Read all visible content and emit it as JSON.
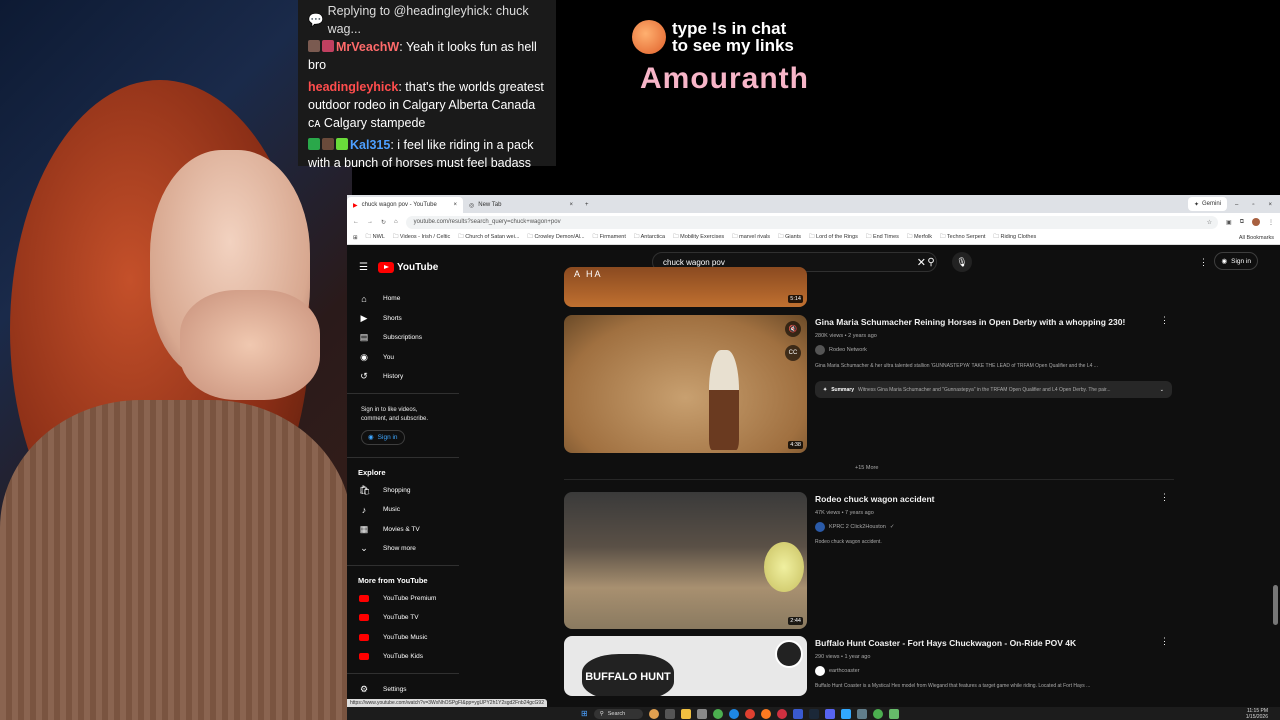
{
  "chat": {
    "reply": "Replying to @headingleyhick: chuck wag...",
    "messages": [
      {
        "user": "MrVeachW",
        "text": "Yeah it looks fun as hell bro"
      },
      {
        "user": "headingleyhick",
        "text": "that's the worlds greatest outdoor rodeo in Calgary Alberta Canada ᴄᴀ Calgary stampede"
      },
      {
        "user": "Kal315",
        "text": "i feel like riding in a pack with a bunch of horses must feel badass"
      }
    ]
  },
  "promo": {
    "line1": "type !s in chat",
    "line2": "to see my links",
    "name": "Amouranth"
  },
  "browser": {
    "tabs": [
      "chuck wagon pov - YouTube",
      "New Tab"
    ],
    "gemini": "Gemini",
    "url": "youtube.com/results?search_query=chuck+wagon+pov",
    "bookmarks": [
      "NWL",
      "Videos - Irish / Celtic",
      "Church of Satan wei...",
      "Crowley Demon/Al...",
      "Firmament",
      "Antarctica",
      "Mobility Exercises",
      "marvel rivals",
      "Giants",
      "Lord of the Rings",
      "End Times",
      "Merfolk",
      "Techno Serpent",
      "Riding Clothes"
    ],
    "all_bookmarks": "All Bookmarks",
    "status_url": "https://www.youtube.com/watch?v=3WxNhOSPgFI&pp=ygUPY2h1Y2sgd2Fnb24gcG92"
  },
  "youtube": {
    "logo": "YouTube",
    "search_value": "chuck wagon pov",
    "signin": "Sign in",
    "sidebar": {
      "main": [
        {
          "icon": "home-icon",
          "glyph": "⌂",
          "label": "Home"
        },
        {
          "icon": "shorts-icon",
          "glyph": "▶",
          "label": "Shorts"
        },
        {
          "icon": "subscriptions-icon",
          "glyph": "▤",
          "label": "Subscriptions"
        },
        {
          "icon": "you-icon",
          "glyph": "◉",
          "label": "You"
        },
        {
          "icon": "history-icon",
          "glyph": "↺",
          "label": "History"
        }
      ],
      "signin_text": "Sign in to like videos, comment, and subscribe.",
      "signin_btn": "Sign in",
      "explore_title": "Explore",
      "explore": [
        {
          "icon": "shopping-icon",
          "glyph": "🛍",
          "label": "Shopping"
        },
        {
          "icon": "music-icon",
          "glyph": "♪",
          "label": "Music"
        },
        {
          "icon": "movies-icon",
          "glyph": "▦",
          "label": "Movies & TV"
        },
        {
          "icon": "chevron-down-icon",
          "glyph": "⌄",
          "label": "Show more"
        }
      ],
      "more_title": "More from YouTube",
      "more": [
        "YouTube Premium",
        "YouTube TV",
        "YouTube Music",
        "YouTube Kids"
      ],
      "settings": "Settings"
    },
    "results": [
      {
        "duration": "5:14",
        "thumb_text": "A HA"
      },
      {
        "title": "Gina Maria Schumacher Reining Horses in Open Derby with a whopping 230!",
        "meta": "280K views • 2 years ago",
        "channel": "Rodeo Network",
        "desc": "Gina Maria Schumacher & her ultra talented stallion 'GUNNASTEPYA' TAKE THE LEAD of TRFAM Open Qualifier and the L4 ...",
        "summary_label": "Summary",
        "summary_text": "Witness Gina Maria Schumacher and \"Gunnastepya\" in the TRFAM Open Qualifier and L4 Open Derby. The pair...",
        "duration": "4:38",
        "more": "+15 More"
      },
      {
        "title": "Rodeo chuck wagon accident",
        "meta": "47K views • 7 years ago",
        "channel": "KPRC 2 Click2Houston",
        "desc": "Rodeo chuck wagon accident.",
        "duration": "2:44"
      },
      {
        "title": "Buffalo Hunt Coaster - Fort Hays Chuckwagon - On-Ride POV 4K",
        "meta": "290 views • 1 year ago",
        "channel": "earthcoaster",
        "desc": "Buffalo Hunt Coaster is a Mystical Hex model from Wiegand that features a target game while riding. Located at Fort Hays ...",
        "thumb_text": "BUFFALO HUNT"
      }
    ]
  },
  "taskbar": {
    "search": "Search",
    "time": "11:15 PM",
    "date": "1/15/2026"
  }
}
